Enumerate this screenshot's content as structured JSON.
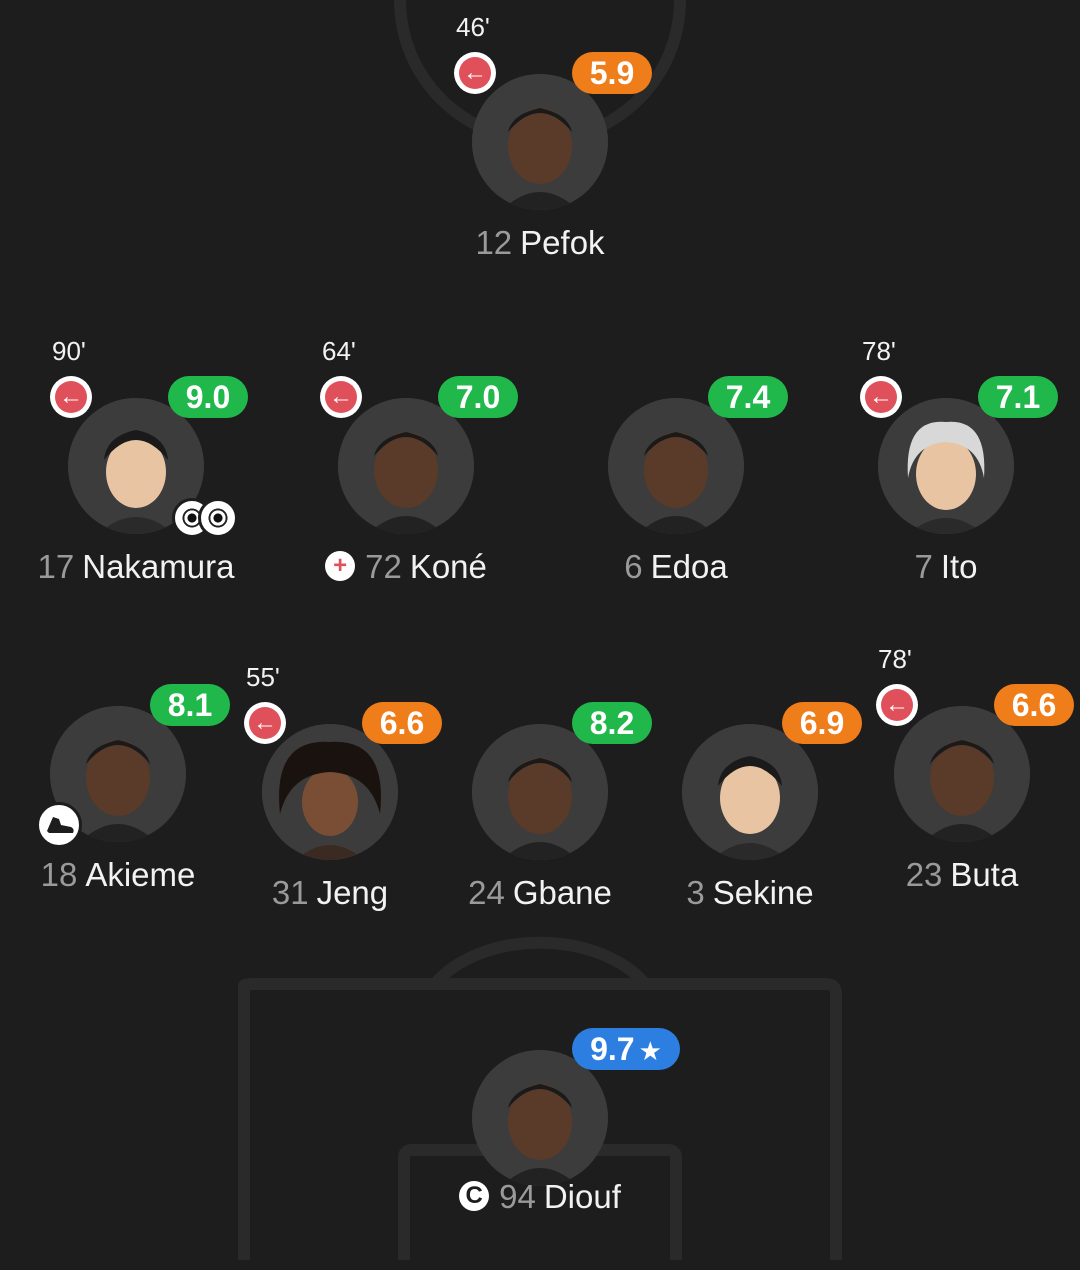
{
  "colors": {
    "background": "#1d1d1d",
    "rating_green": "#21b84b",
    "rating_orange": "#ef7d1a",
    "rating_blue": "#2c7fe0",
    "sub_red": "#e0505a"
  },
  "players": {
    "pefok": {
      "number": "12",
      "name": "Pefok",
      "rating": "5.9",
      "sub_minute": "46'"
    },
    "nakamura": {
      "number": "17",
      "name": "Nakamura",
      "rating": "9.0",
      "sub_minute": "90'"
    },
    "kone": {
      "number": "72",
      "name": "Koné",
      "rating": "7.0",
      "sub_minute": "64'"
    },
    "edoa": {
      "number": "6",
      "name": "Edoa",
      "rating": "7.4"
    },
    "ito": {
      "number": "7",
      "name": "Ito",
      "rating": "7.1",
      "sub_minute": "78'"
    },
    "akieme": {
      "number": "18",
      "name": "Akieme",
      "rating": "8.1"
    },
    "jeng": {
      "number": "31",
      "name": "Jeng",
      "rating": "6.6",
      "sub_minute": "55'"
    },
    "gbane": {
      "number": "24",
      "name": "Gbane",
      "rating": "8.2"
    },
    "sekine": {
      "number": "3",
      "name": "Sekine",
      "rating": "6.9"
    },
    "buta": {
      "number": "23",
      "name": "Buta",
      "rating": "6.6",
      "sub_minute": "78'"
    },
    "diouf": {
      "number": "94",
      "name": "Diouf",
      "rating": "9.7"
    }
  },
  "icons": {
    "sub_out": "arrow-left-icon",
    "goal": "football-icon",
    "assist": "boot-icon",
    "injury": "plus-icon",
    "captain": "captain-c-icon",
    "top_rated": "star-icon"
  },
  "glyphs": {
    "sub_out": "←",
    "injury": "+",
    "captain": "C",
    "star": "★"
  }
}
